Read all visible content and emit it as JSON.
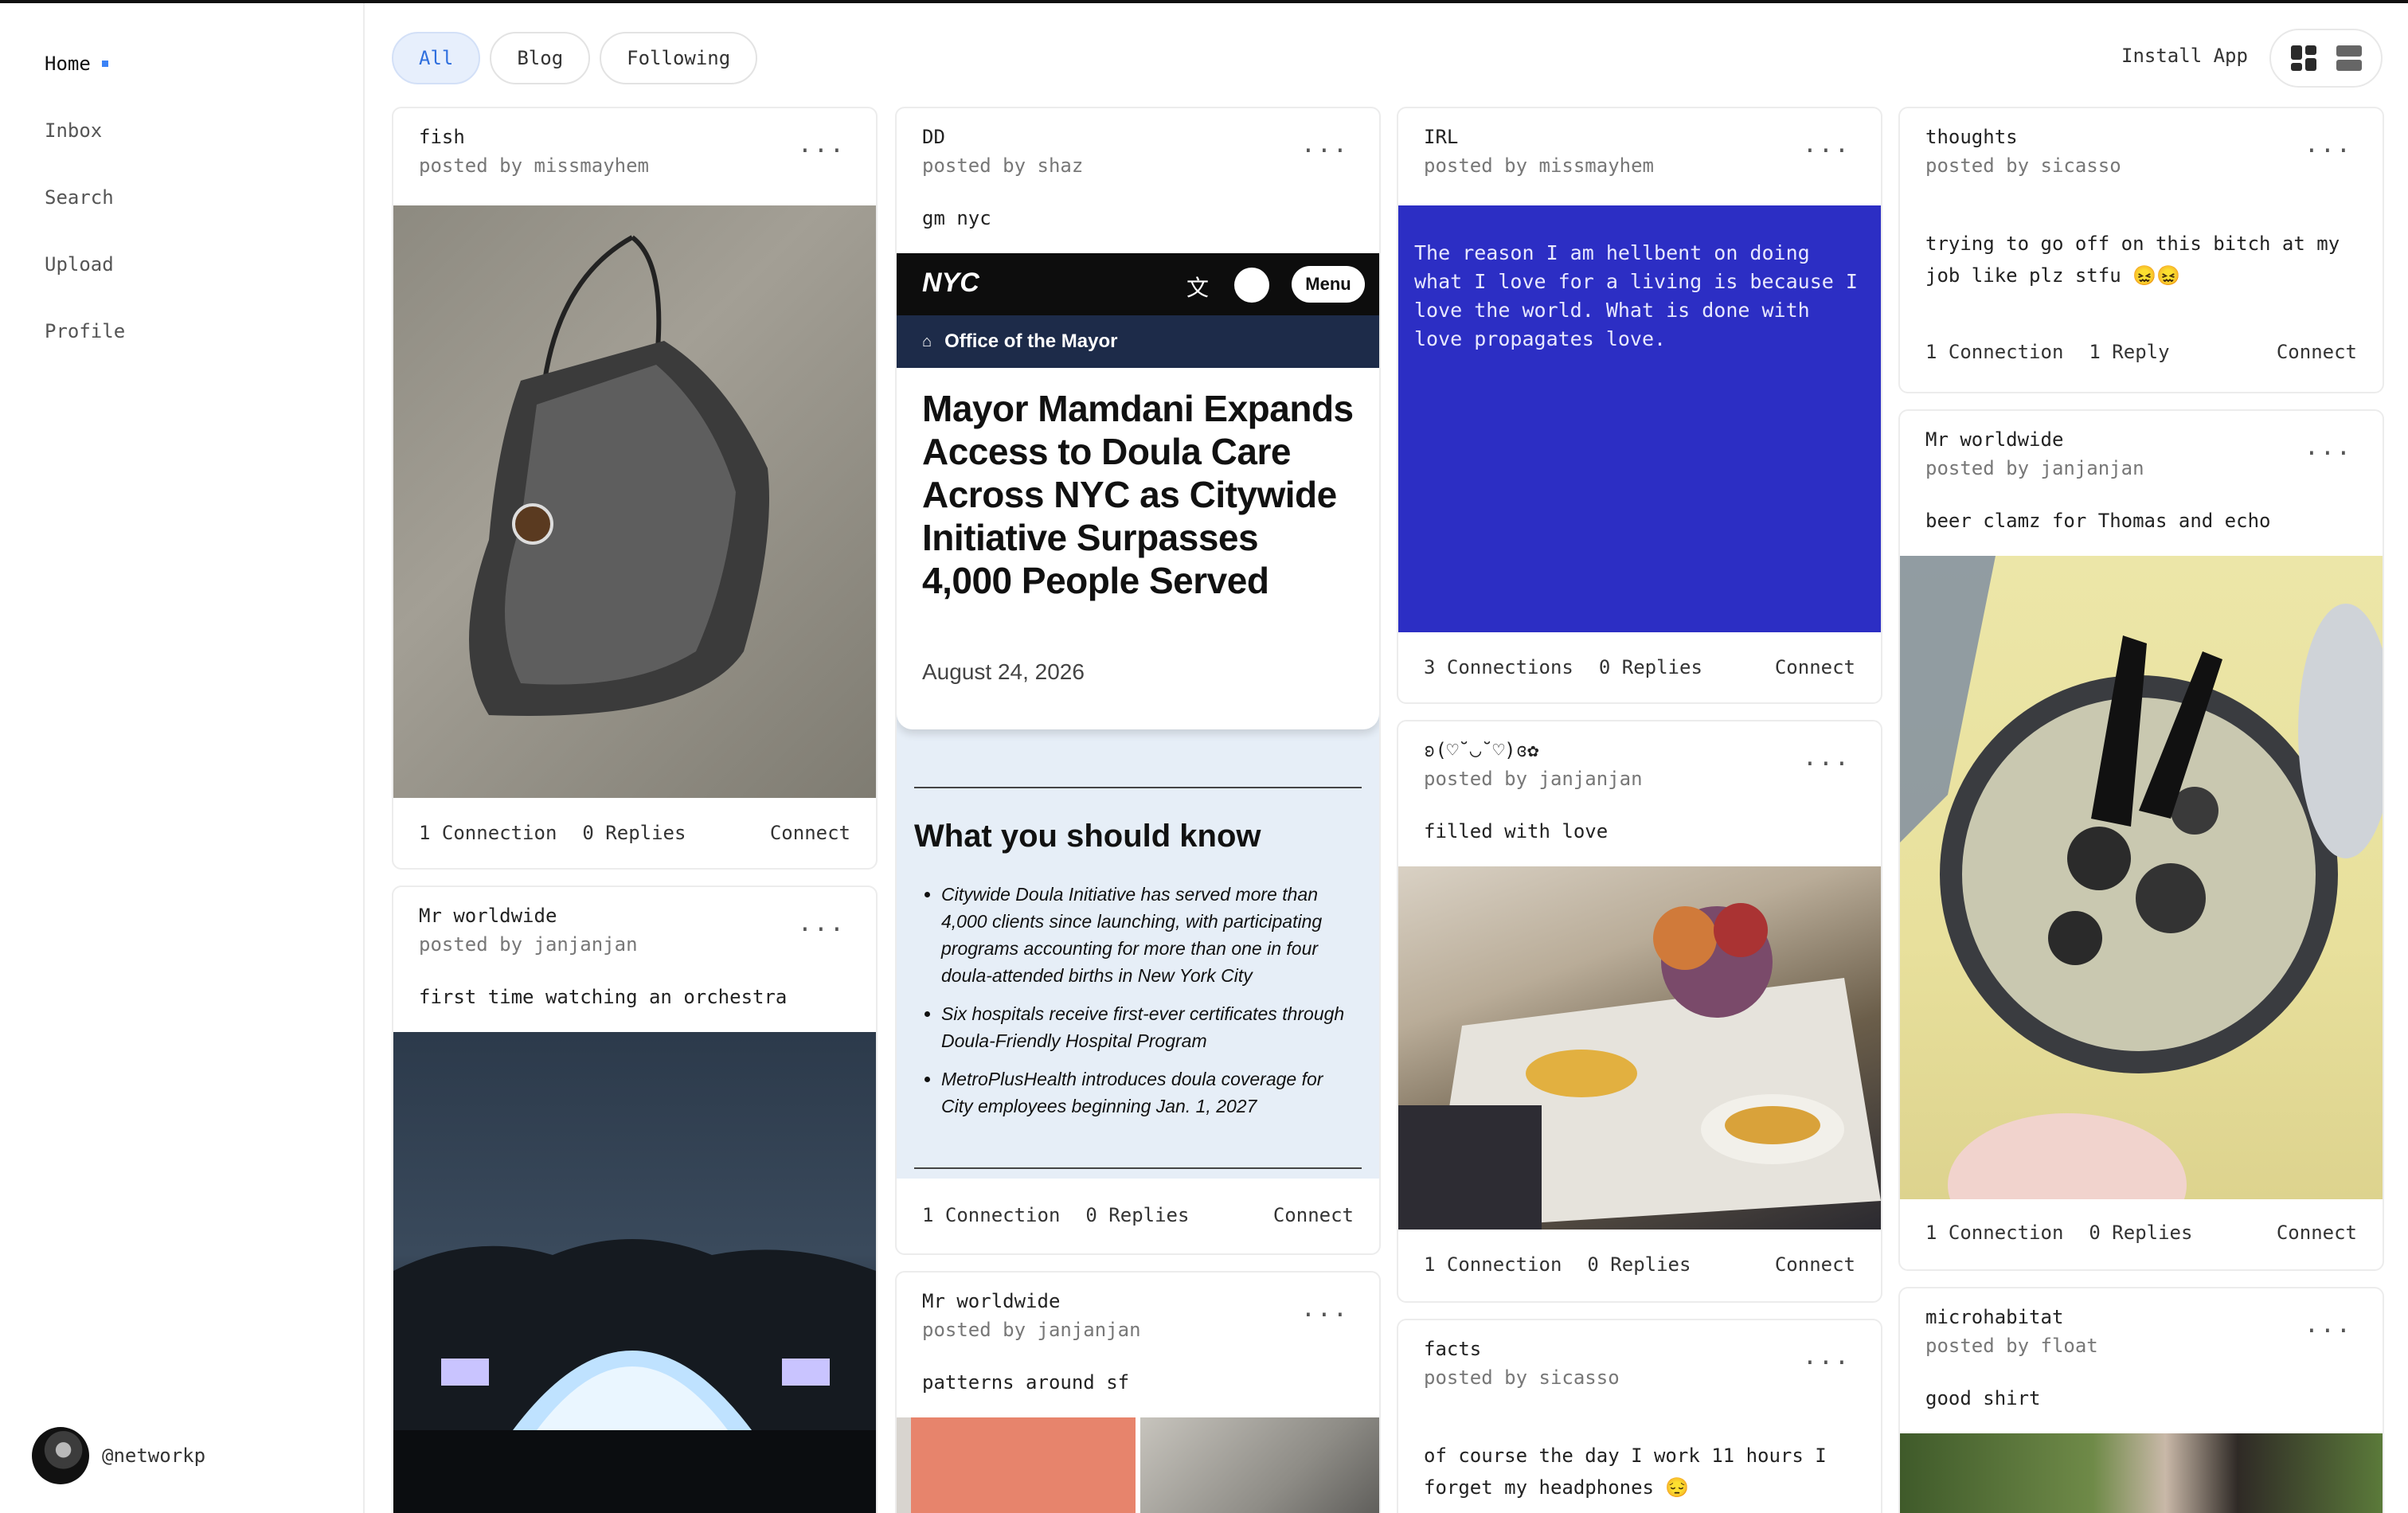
{
  "sidebar": {
    "items": [
      {
        "label": "Home",
        "active": true
      },
      {
        "label": "Inbox"
      },
      {
        "label": "Search"
      },
      {
        "label": "Upload"
      },
      {
        "label": "Profile"
      }
    ],
    "user": "@networkp"
  },
  "filters": {
    "all": "All",
    "blog": "Blog",
    "following": "Following"
  },
  "install_label": "Install App",
  "more_glyph": "...",
  "col1": {
    "c1": {
      "title": "fish",
      "by": "posted by missmayhem",
      "connections": "1 Connection",
      "replies": "0 Replies",
      "connect": "Connect"
    },
    "c2": {
      "title": "Mr worldwide",
      "by": "posted by janjanjan",
      "caption": "first time watching an orchestra"
    }
  },
  "col2": {
    "c1": {
      "title": "DD",
      "by": "posted by shaz",
      "caption": "gm nyc",
      "embed": {
        "logo": "NYC",
        "menu": "Menu",
        "office": "Office of the Mayor",
        "headline": "Mayor Mamdani Expands Access to Doula Care Across NYC as Citywide Initiative Surpasses 4,000 People Served",
        "date": "August 24, 2026",
        "know_title": "What you should know",
        "bullets": [
          "Citywide Doula Initiative has served more than 4,000 clients since launching, with participating programs accounting for more than one in four doula-attended births in New York City",
          "Six hospitals receive first-ever certificates through Doula-Friendly Hospital Program",
          "MetroPlusHealth introduces doula coverage for City employees beginning Jan. 1, 2027"
        ]
      },
      "connections": "1 Connection",
      "replies": "0 Replies",
      "connect": "Connect"
    },
    "c2": {
      "title": "Mr worldwide",
      "by": "posted by janjanjan",
      "caption": "patterns around sf"
    }
  },
  "col3": {
    "c1": {
      "title": "IRL",
      "by": "posted by missmayhem",
      "quote": "The reason I am hellbent on doing what I love for a living is because I love the world. What is done with love propagates love.",
      "connections": "3 Connections",
      "replies": "0 Replies",
      "connect": "Connect"
    },
    "c2": {
      "title": "ʚ(♡˘◡˘♡)ɞ✿",
      "by": "posted by janjanjan",
      "caption": "filled with love",
      "connections": "1 Connection",
      "replies": "0 Replies",
      "connect": "Connect"
    },
    "c3": {
      "title": "facts",
      "by": "posted by sicasso",
      "caption": "of course the day I work 11 hours I forget my headphones 😔"
    }
  },
  "col4": {
    "c1": {
      "title": "thoughts",
      "by": "posted by sicasso",
      "caption": "trying to go off on this bitch at my job like plz stfu 😖😖",
      "connections": "1 Connection",
      "replies": "1 Reply",
      "connect": "Connect"
    },
    "c2": {
      "title": "Mr worldwide",
      "by": "posted by janjanjan",
      "caption": "beer clamz for Thomas and echo",
      "connections": "1 Connection",
      "replies": "0 Replies",
      "connect": "Connect"
    },
    "c3": {
      "title": "microhabitat",
      "by": "posted by float",
      "caption": "good shirt"
    }
  }
}
